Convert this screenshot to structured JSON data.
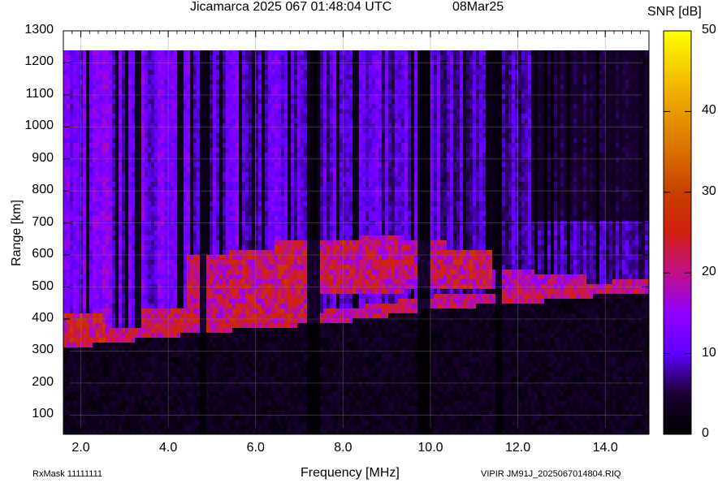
{
  "header": {
    "title": "Jicamarca 2025 067 01:48:04 UTC",
    "date": "08Mar25"
  },
  "colorbar": {
    "label": "SNR [dB]",
    "ticks": [
      "50",
      "40",
      "30",
      "20",
      "10",
      "0"
    ]
  },
  "footer": {
    "rxmask": "RxMask 11111111",
    "filename": "VIPIR  JM91J_2025067014804.RIQ"
  },
  "chart_data": {
    "type": "heatmap",
    "title": "Jicamarca 2025 067 01:48:04 UTC",
    "xlabel": "Frequency [MHz]",
    "ylabel": "Range [km]",
    "xlim": [
      1.6,
      15.0
    ],
    "ylim": [
      40,
      1300
    ],
    "x_ticks": [
      2.0,
      4.0,
      6.0,
      8.0,
      10.0,
      12.0,
      14.0
    ],
    "x_tick_labels": [
      "2.0",
      "4.0",
      "6.0",
      "8.0",
      "10.0",
      "12.0",
      "14.0"
    ],
    "y_ticks": [
      100,
      200,
      300,
      400,
      500,
      600,
      700,
      800,
      900,
      1000,
      1100,
      1200,
      1300
    ],
    "y_tick_labels": [
      "100",
      "200",
      "300",
      "400",
      "500",
      "600",
      "700",
      "800",
      "900",
      "1000",
      "1100",
      "1200",
      "1300"
    ],
    "colorbar": {
      "label": "SNR [dB]",
      "range": [
        0,
        50
      ]
    },
    "grid": true,
    "data_range_top_km": 1240,
    "echo_trace": {
      "frequency_mhz": [
        1.6,
        2.0,
        3.0,
        4.0,
        5.0,
        6.0,
        7.0,
        8.0,
        9.0,
        10.0,
        11.0,
        12.0,
        13.0,
        14.0,
        15.0
      ],
      "range_km": [
        310,
        315,
        330,
        345,
        360,
        370,
        380,
        390,
        410,
        430,
        440,
        450,
        460,
        475,
        485
      ]
    },
    "peak_region": {
      "frequency_mhz": [
        2.0,
        4.0,
        5.0,
        6.0,
        7.0,
        8.0,
        9.0,
        10.0,
        11.0,
        12.0,
        13.0
      ],
      "range_km": [
        [
          320,
          420
        ],
        [
          360,
          440
        ],
        [
          380,
          600
        ],
        [
          390,
          620
        ],
        [
          400,
          650
        ],
        [
          480,
          650
        ],
        [
          480,
          660
        ],
        [
          490,
          640
        ],
        [
          490,
          620
        ],
        [
          500,
          560
        ],
        [
          500,
          540
        ]
      ],
      "snr_db": [
        28,
        26,
        25,
        26,
        27,
        26,
        25,
        25,
        27,
        22,
        23
      ]
    },
    "quiet_frequency_bands_mhz": [
      [
        4.7,
        4.85
      ],
      [
        7.2,
        7.5
      ],
      [
        9.7,
        10.0
      ],
      [
        11.5,
        11.65
      ]
    ]
  }
}
